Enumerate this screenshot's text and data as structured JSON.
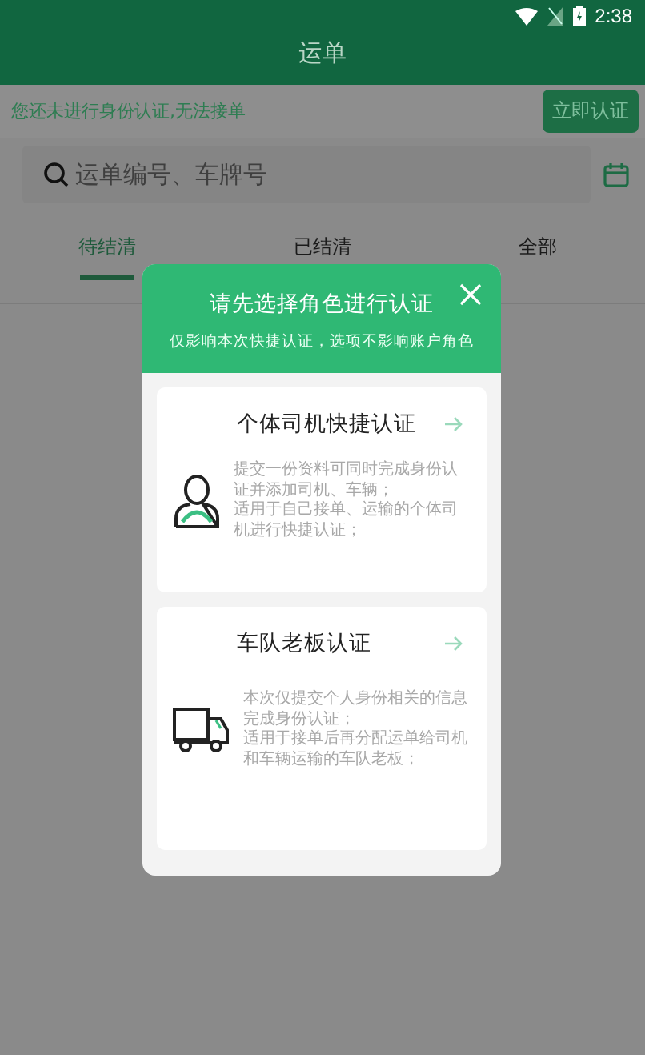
{
  "status_bar": {
    "time": "2:38"
  },
  "window": {
    "title": "运单"
  },
  "notice": {
    "text": "您还未进行身份认证,无法接单",
    "button": "立即认证"
  },
  "search": {
    "placeholder": "运单编号、车牌号"
  },
  "tabs": [
    {
      "label": "待结清",
      "selected": true
    },
    {
      "label": "已结清",
      "selected": false
    },
    {
      "label": "全部",
      "selected": false
    }
  ],
  "dialog": {
    "title": "请先选择角色进行认证",
    "subtitle": "仅影响本次快捷认证，选项不影响账户角色",
    "options": [
      {
        "kind": "driver",
        "title": "个体司机快捷认证",
        "description": [
          "提交一份资料可同时完成身份认证并添加司机、车辆；",
          "适用于自己接单、运输的个体司机进行快捷认证；"
        ]
      },
      {
        "kind": "fleet",
        "title": "车队老板认证",
        "description": [
          "本次仅提交个人身份相关的信息完成身份认证；",
          "适用于接单后再分配运单给司机和车辆运输的车队老板；"
        ]
      }
    ]
  }
}
